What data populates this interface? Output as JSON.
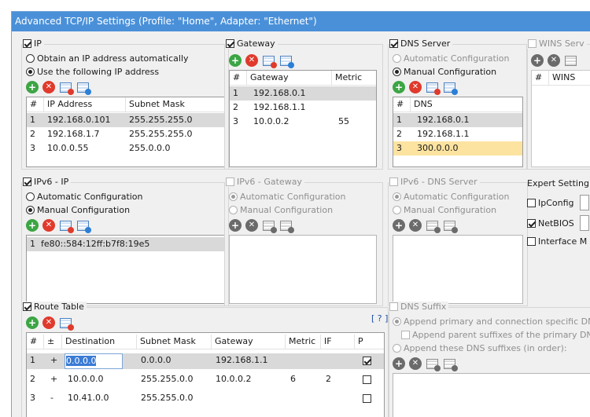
{
  "title": "Advanced TCP/IP Settings (Profile: \"Home\", Adapter: \"Ethernet\")",
  "ip": {
    "label": "IP",
    "radio_auto": "Obtain an IP address automatically",
    "radio_manual": "Use the following IP address",
    "headers": [
      "#",
      "IP Address",
      "Subnet Mask"
    ],
    "rows": [
      [
        "1",
        "192.168.0.101",
        "255.255.255.0"
      ],
      [
        "2",
        "192.168.1.7",
        "255.255.255.0"
      ],
      [
        "3",
        "10.0.0.55",
        "255.0.0.0"
      ]
    ]
  },
  "gateway": {
    "label": "Gateway",
    "headers": [
      "#",
      "Gateway",
      "Metric"
    ],
    "rows": [
      [
        "1",
        "192.168.0.1",
        ""
      ],
      [
        "2",
        "192.168.1.1",
        ""
      ],
      [
        "3",
        "10.0.0.2",
        "55"
      ]
    ]
  },
  "dns": {
    "label": "DNS Server",
    "radio_auto": "Automatic Configuration",
    "radio_manual": "Manual Configuration",
    "headers": [
      "#",
      "DNS"
    ],
    "rows": [
      [
        "1",
        "192.168.0.1"
      ],
      [
        "2",
        "192.168.1.1"
      ],
      [
        "3",
        "300.0.0.0"
      ]
    ]
  },
  "wins": {
    "label": "WINS Serv",
    "headers": [
      "#",
      "WINS"
    ]
  },
  "ipv6": {
    "label": "IPv6 - IP",
    "radio_auto": "Automatic Configuration",
    "radio_manual": "Manual Configuration",
    "rows": [
      [
        "1",
        "fe80::584:12ff:b7f8:19e5"
      ]
    ]
  },
  "ipv6_gateway": {
    "label": "IPv6 - Gateway",
    "radio_auto": "Automatic Configuration",
    "radio_manual": "Manual Configuration"
  },
  "ipv6_dns": {
    "label": "IPv6 - DNS Server",
    "radio_auto": "Automatic Configuration",
    "radio_manual": "Manual Configuration"
  },
  "expert": {
    "label": "Expert Setting",
    "ipconfig": "IpConfig",
    "netbios": "NetBIOS",
    "interface": "Interface M"
  },
  "route": {
    "label": "Route Table",
    "help": "[ ? ]",
    "headers": [
      "#",
      "±",
      "Destination",
      "Subnet Mask",
      "Gateway",
      "Metric",
      "IF",
      "P"
    ],
    "rows": [
      [
        "1",
        "+",
        "0.0.0.0",
        "0.0.0.0",
        "192.168.1.1",
        "",
        "",
        "checked"
      ],
      [
        "2",
        "+",
        "10.0.0.0",
        "255.255.0.0",
        "10.0.0.2",
        "6",
        "2",
        "unchecked"
      ],
      [
        "3",
        "-",
        "10.41.0.0",
        "255.255.0.0",
        "",
        "",
        "",
        "unchecked"
      ]
    ]
  },
  "dns_suffix": {
    "label": "DNS Suffix",
    "opt1": "Append primary and connection specific DNS s",
    "opt2": "Append parent suffixes of the primary DNS s",
    "opt3": "Append these DNS suffixes (in order):"
  }
}
